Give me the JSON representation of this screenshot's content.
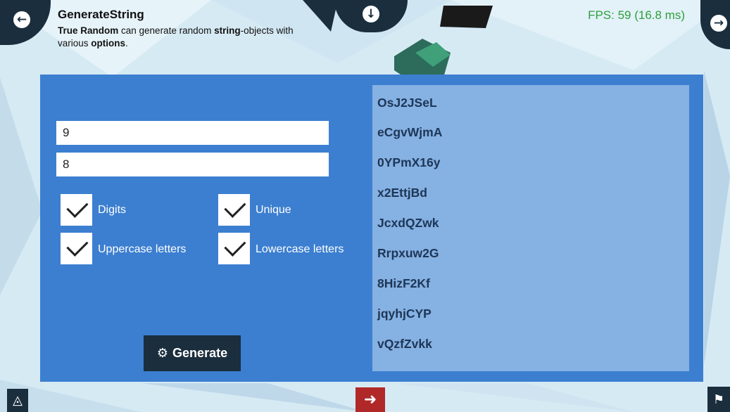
{
  "header": {
    "title": "GenerateString",
    "desc_bold1": "True Random",
    "desc_t1": " can generate random ",
    "desc_bold2": "string",
    "desc_t2": "-objects with various ",
    "desc_bold3": "options",
    "desc_t3": "."
  },
  "fps": "FPS: 59 (16.8 ms)",
  "inputs": {
    "number_value": "9",
    "length_value": "8"
  },
  "options": {
    "digits": {
      "label": "Digits",
      "checked": true
    },
    "unique": {
      "label": "Unique",
      "checked": true
    },
    "uppercase": {
      "label": "Uppercase letters",
      "checked": true
    },
    "lowercase": {
      "label": "Lowercase letters",
      "checked": true
    }
  },
  "generate_label": "Generate",
  "results": [
    "OsJ2JSeL",
    "eCgvWjmA",
    "0YPmX16y",
    "x2EttjBd",
    "JcxdQZwk",
    "Rrpxuw2G",
    "8HizF2Kf",
    "jqyhjCYP",
    "vQzfZvkk"
  ],
  "icons": {
    "prev": "arrow-left-circle-icon",
    "next": "arrow-right-circle-icon",
    "down": "arrow-down-circle-icon",
    "gear": "gear-icon",
    "unity": "unity-logo-icon",
    "exit": "exit-icon",
    "flag": "flag-icon"
  },
  "colors": {
    "panel": "#3c7fd0",
    "results": "#86b1e3",
    "dark": "#1a2e3d",
    "fps": "#2e9f3c",
    "exit": "#b02828"
  }
}
